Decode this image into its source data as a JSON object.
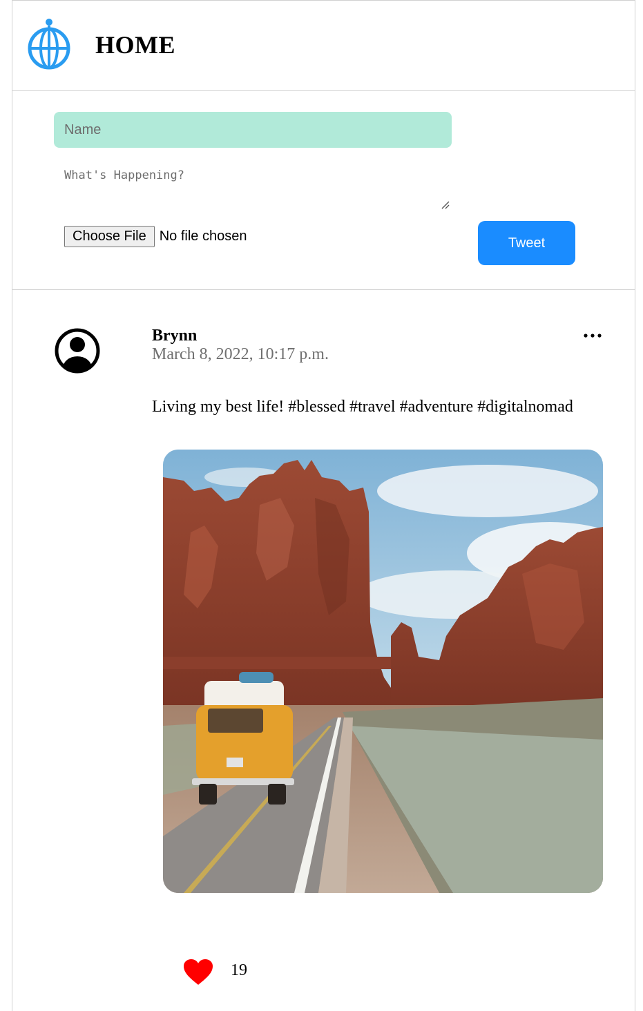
{
  "header": {
    "title": "HOME",
    "logo_icon": "globe-icon",
    "accent_color": "#2a9cf0"
  },
  "composer": {
    "name_placeholder": "Name",
    "name_value": "",
    "text_placeholder": "What's Happening?",
    "text_value": "",
    "file_button_label": "Choose File",
    "file_status": "No file chosen",
    "tweet_label": "Tweet",
    "name_bg_color": "#b1ead9",
    "tweet_bg_color": "#1a8cff"
  },
  "post": {
    "author": "Brynn",
    "timestamp": "March 8, 2022, 10:17 p.m.",
    "text": "Living my best life! #blessed #travel #adventure #digitalnomad",
    "avatar_icon": "user-avatar-icon",
    "more_icon": "more-options-icon",
    "image_subject": "yellow-van-desert-road-photo",
    "like_icon": "heart-icon",
    "like_color": "#ff0000",
    "likes": "19"
  }
}
